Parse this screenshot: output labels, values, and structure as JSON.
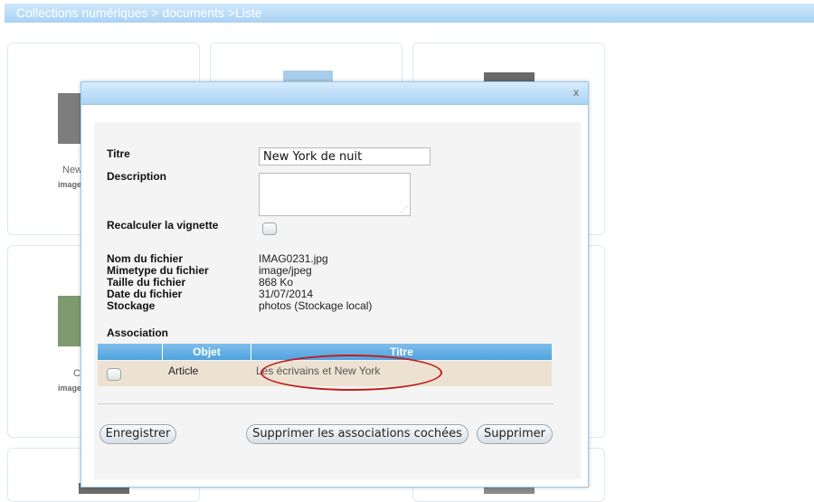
{
  "breadcrumb": "Collections numériques > documents >Liste",
  "background_tiles": {
    "captions": [
      "New",
      "image",
      "C",
      "image"
    ]
  },
  "dialog": {
    "close_label": "x",
    "fields": {
      "titre_label": "Titre",
      "titre_value": "New York de nuit",
      "description_label": "Description",
      "description_value": "",
      "recalc_label": "Recalculer la vignette"
    },
    "file_info": [
      {
        "label": "Nom du fichier",
        "value": "IMAG0231.jpg"
      },
      {
        "label": "Mimetype du fichier",
        "value": "image/jpeg"
      },
      {
        "label": "Taille du fichier",
        "value": "868 Ko"
      },
      {
        "label": "Date du fichier",
        "value": "31/07/2014"
      },
      {
        "label": "Stockage",
        "value": "photos (Stockage local)"
      }
    ],
    "association": {
      "label": "Association",
      "columns": [
        "",
        "Objet",
        "Titre"
      ],
      "rows": [
        {
          "objet": "Article",
          "titre": "Les écrivains et New York"
        }
      ]
    },
    "buttons": {
      "save": "Enregistrer",
      "delete_associations": "Supprimer les associations cochées",
      "delete": "Supprimer"
    }
  },
  "colors": {
    "header_blue": "#a8d2f4",
    "table_header": "#4fa3df",
    "row_bg": "#ede2d2",
    "annotation_red": "#c21d1d"
  }
}
